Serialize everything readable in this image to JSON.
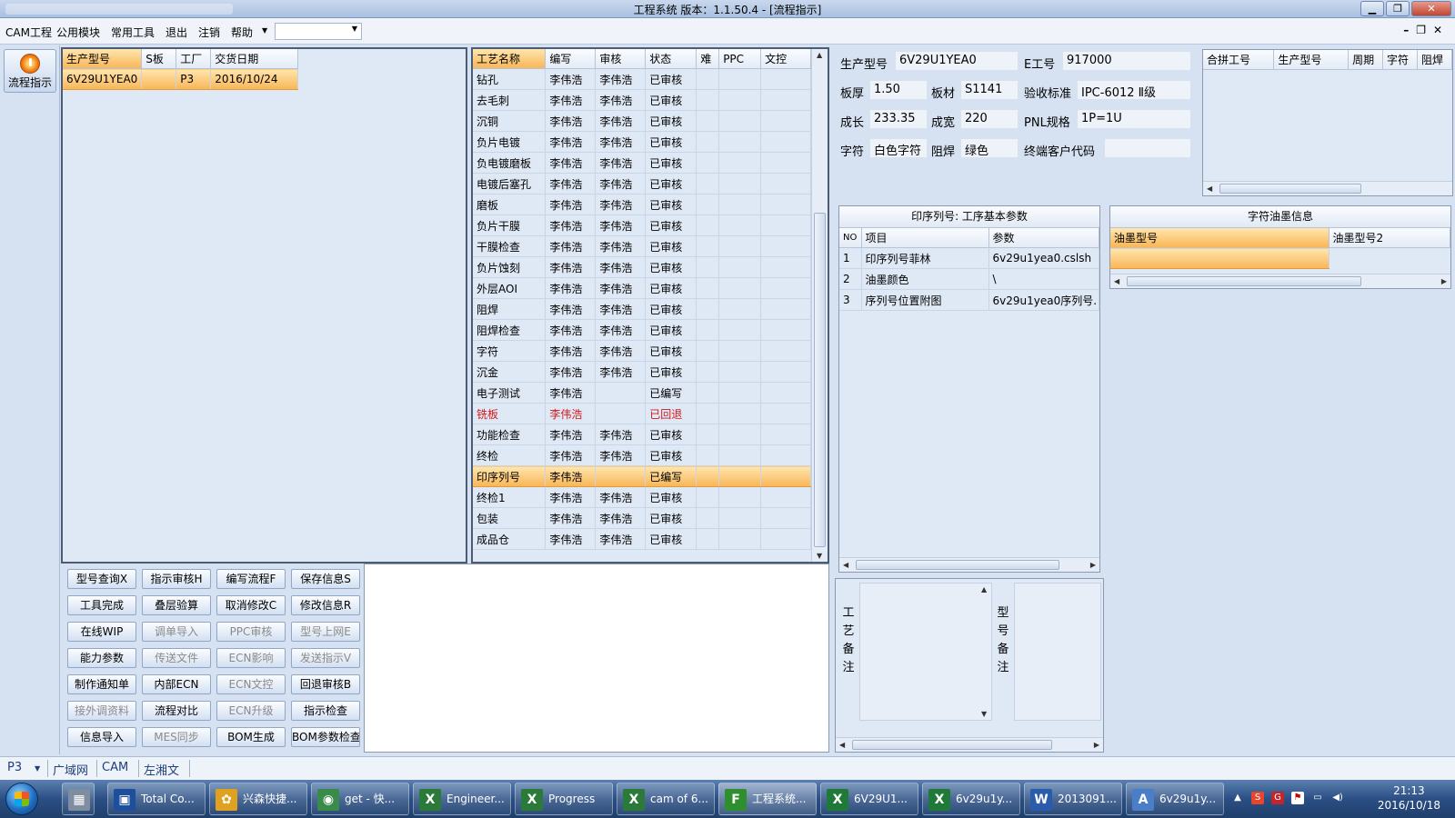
{
  "window": {
    "title": "工程系统   版本：1.1.50.4 - [流程指示]"
  },
  "menu": {
    "items": [
      "CAM工程",
      "公用模块",
      "常用工具",
      "退出",
      "注销",
      "帮助"
    ],
    "combo_value": ""
  },
  "flow_button": {
    "label": "流程指示"
  },
  "model_grid": {
    "columns": [
      "生产型号",
      "S板",
      "工厂",
      "交货日期"
    ],
    "rows": [
      {
        "model": "6V29U1YEA0",
        "sboard": "",
        "factory": "P3",
        "date": "2016/10/24"
      }
    ]
  },
  "process_grid": {
    "columns": [
      "工艺名称",
      "编写",
      "审核",
      "状态",
      "难",
      "PPC",
      "文控"
    ],
    "rows": [
      {
        "name": "钻孔",
        "writer": "李伟浩",
        "reviewer": "李伟浩",
        "status": "已审核"
      },
      {
        "name": "去毛刺",
        "writer": "李伟浩",
        "reviewer": "李伟浩",
        "status": "已审核"
      },
      {
        "name": "沉铜",
        "writer": "李伟浩",
        "reviewer": "李伟浩",
        "status": "已审核"
      },
      {
        "name": "负片电镀",
        "writer": "李伟浩",
        "reviewer": "李伟浩",
        "status": "已审核"
      },
      {
        "name": "负电镀磨板",
        "writer": "李伟浩",
        "reviewer": "李伟浩",
        "status": "已审核"
      },
      {
        "name": "电镀后塞孔",
        "writer": "李伟浩",
        "reviewer": "李伟浩",
        "status": "已审核"
      },
      {
        "name": "磨板",
        "writer": "李伟浩",
        "reviewer": "李伟浩",
        "status": "已审核"
      },
      {
        "name": "负片干膜",
        "writer": "李伟浩",
        "reviewer": "李伟浩",
        "status": "已审核"
      },
      {
        "name": "干膜检查",
        "writer": "李伟浩",
        "reviewer": "李伟浩",
        "status": "已审核"
      },
      {
        "name": "负片蚀刻",
        "writer": "李伟浩",
        "reviewer": "李伟浩",
        "status": "已审核"
      },
      {
        "name": "外层AOI",
        "writer": "李伟浩",
        "reviewer": "李伟浩",
        "status": "已审核"
      },
      {
        "name": "阻焊",
        "writer": "李伟浩",
        "reviewer": "李伟浩",
        "status": "已审核"
      },
      {
        "name": "阻焊检查",
        "writer": "李伟浩",
        "reviewer": "李伟浩",
        "status": "已审核"
      },
      {
        "name": "字符",
        "writer": "李伟浩",
        "reviewer": "李伟浩",
        "status": "已审核"
      },
      {
        "name": "沉金",
        "writer": "李伟浩",
        "reviewer": "李伟浩",
        "status": "已审核"
      },
      {
        "name": "电子测试",
        "writer": "李伟浩",
        "reviewer": "",
        "status": "已编写"
      },
      {
        "name": "铣板",
        "writer": "李伟浩",
        "reviewer": "",
        "status": "已回退"
      },
      {
        "name": "功能检查",
        "writer": "李伟浩",
        "reviewer": "李伟浩",
        "status": "已审核"
      },
      {
        "name": "终检",
        "writer": "李伟浩",
        "reviewer": "李伟浩",
        "status": "已审核"
      },
      {
        "name": "印序列号",
        "writer": "李伟浩",
        "reviewer": "",
        "status": "已编写"
      },
      {
        "name": "终检1",
        "writer": "李伟浩",
        "reviewer": "李伟浩",
        "status": "已审核"
      },
      {
        "name": "包装",
        "writer": "李伟浩",
        "reviewer": "李伟浩",
        "status": "已审核"
      },
      {
        "name": "成品仓",
        "writer": "李伟浩",
        "reviewer": "李伟浩",
        "status": "已审核"
      }
    ]
  },
  "actions": [
    [
      "型号查询X",
      "指示审核H",
      "编写流程F",
      "保存信息S"
    ],
    [
      "工具完成",
      "叠层验算",
      "取消修改C",
      "修改信息R"
    ],
    [
      "在线WIP",
      "调单导入",
      "PPC审核",
      "型号上网E"
    ],
    [
      "能力参数",
      "传送文件",
      "ECN影响",
      "发送指示V"
    ],
    [
      "制作通知单",
      "内部ECN",
      "ECN文控",
      "回退审核B"
    ],
    [
      "接外调资料",
      "流程对比",
      "ECN升级",
      "指示检查"
    ],
    [
      "信息导入",
      "MES同步",
      "BOM生成",
      "BOM参数检查"
    ]
  ],
  "info": {
    "model_label": "生产型号",
    "model_value": "6V29U1YEA0",
    "eno_label": "E工号",
    "eno_value": "917000",
    "thickness_label": "板厚",
    "thickness_value": "1.50",
    "material_label": "板材",
    "material_value": "S1141",
    "standard_label": "验收标准",
    "standard_value": "IPC-6012 Ⅱ级",
    "length_label": "成长",
    "length_value": "233.35",
    "width_label": "成宽",
    "width_value": "220",
    "pnl_label": "PNL规格",
    "pnl_value": "1P=1U",
    "char_label": "字符",
    "char_value": "白色字符",
    "mask_label": "阻焊",
    "mask_value": "绿色",
    "customer_label": "终端客户代码",
    "customer_value": ""
  },
  "merge_grid": {
    "columns": [
      "合拼工号",
      "生产型号",
      "周期",
      "字符",
      "阻焊"
    ]
  },
  "params": {
    "title": "印序列号: 工序基本参数",
    "columns": [
      "NO",
      "项目",
      "参数"
    ],
    "rows": [
      {
        "no": "1",
        "item": "印序列号菲林",
        "param": "6v29u1yea0.cslsh"
      },
      {
        "no": "2",
        "item": "油墨颜色",
        "param": "\\"
      },
      {
        "no": "3",
        "item": "序列号位置附图",
        "param": "6v29u1yea0序列号."
      }
    ]
  },
  "ink": {
    "title": "字符油墨信息",
    "columns": [
      "油墨型号",
      "油墨型号2"
    ]
  },
  "remarks": {
    "process_label": [
      "工",
      "艺",
      "备",
      "注"
    ],
    "model_label": [
      "型",
      "号",
      "备",
      "注"
    ]
  },
  "status": {
    "factory": "P3",
    "network": "广域网",
    "dept": "CAM",
    "user": "左湘文"
  },
  "taskbar": {
    "items": [
      "Total Co...",
      "兴森快捷...",
      "get - 快...",
      "Engineer...",
      "Progress",
      "cam of 6...",
      "工程系统...",
      "6V29U1...",
      "6v29u1y...",
      "2013091...",
      "6v29u1y..."
    ],
    "clock_time": "21:13",
    "clock_date": "2016/10/18"
  },
  "colors": {
    "selection": "#f8b657",
    "rollback": "#d11a1a",
    "taskbar": "#2b4f84"
  }
}
